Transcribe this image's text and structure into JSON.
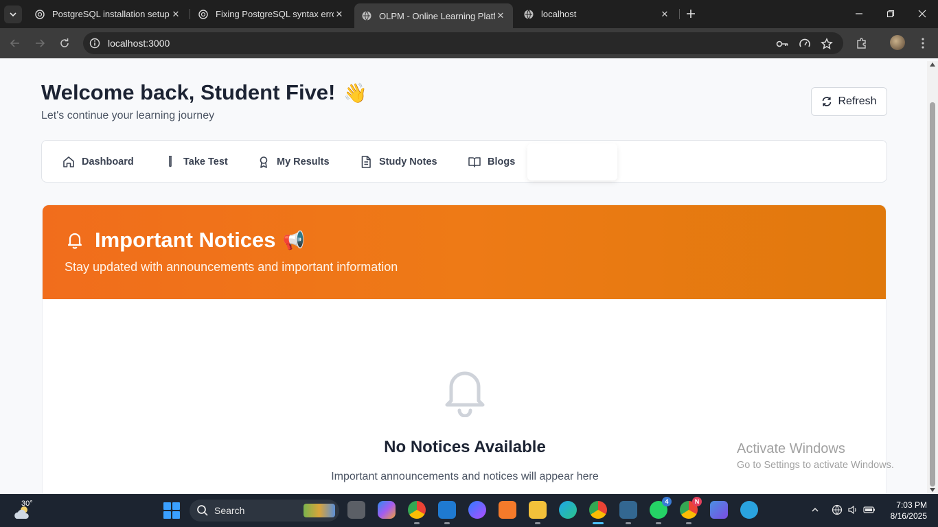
{
  "browser": {
    "tabs": [
      {
        "title": "PostgreSQL installation setup",
        "active": false
      },
      {
        "title": "Fixing PostgreSQL syntax error",
        "active": false
      },
      {
        "title": "OLPM - Online Learning Platform",
        "active": true
      },
      {
        "title": "localhost",
        "active": false
      }
    ],
    "url": "localhost:3000"
  },
  "page": {
    "welcome_title": "Welcome back, Student Five!",
    "welcome_emoji": "👋",
    "welcome_subtitle": "Let's continue your learning journey",
    "refresh_label": "Refresh",
    "nav": [
      {
        "label": "Dashboard",
        "icon": "home-icon"
      },
      {
        "label": "Take Test",
        "icon": "test-tube-icon"
      },
      {
        "label": "My Results",
        "icon": "award-icon"
      },
      {
        "label": "Study Notes",
        "icon": "document-icon"
      },
      {
        "label": "Blogs",
        "icon": "book-open-icon"
      }
    ],
    "notices": {
      "title": "Important Notices",
      "emoji": "📢",
      "subtitle": "Stay updated with announcements and important information",
      "empty_title": "No Notices Available",
      "empty_subtitle": "Important announcements and notices will appear here"
    },
    "accent_color": "#f16d1c"
  },
  "watermark": {
    "line1": "Activate Windows",
    "line2": "Go to Settings to activate Windows."
  },
  "taskbar": {
    "weather_temp": "30°",
    "search_label": "Search",
    "whatsapp_badge": "4",
    "chrome_profile_badge": "N",
    "time": "7:03 PM",
    "date": "8/16/2025"
  }
}
